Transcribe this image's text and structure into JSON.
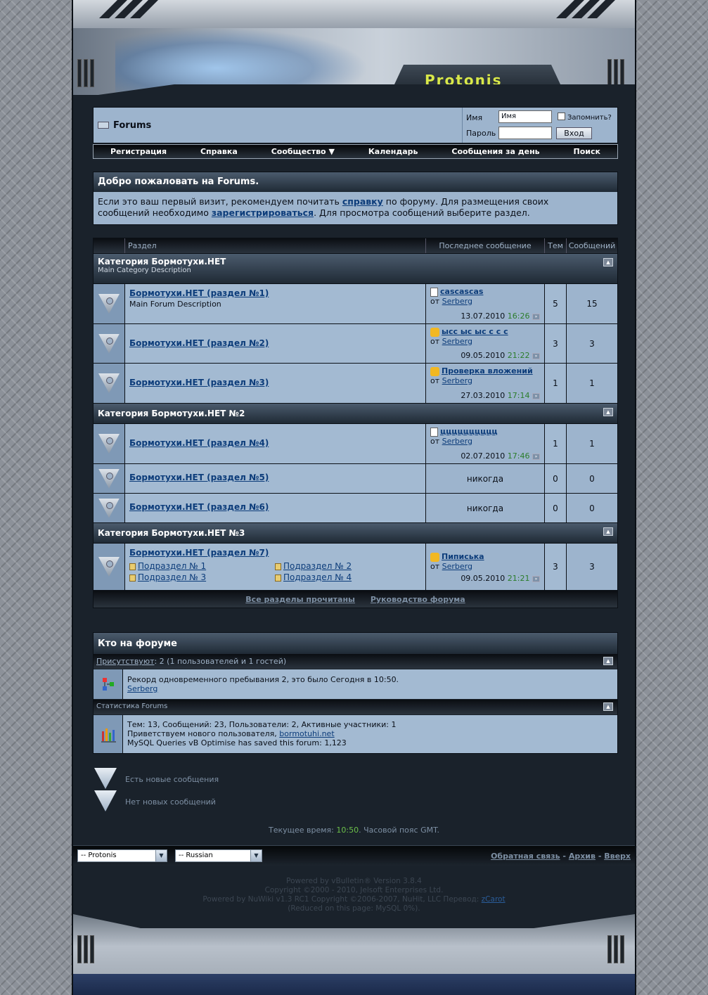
{
  "site": {
    "logo": "Protonis",
    "forum_title": "Forums"
  },
  "login": {
    "user_label": "Имя",
    "user_value": "Имя",
    "remember_label": "Запомнить?",
    "pass_label": "Пароль",
    "login_button": "Вход"
  },
  "nav": [
    "Регистрация",
    "Справка",
    "Сообщество",
    "Календарь",
    "Сообщения за день",
    "Поиск"
  ],
  "welcome": {
    "title": "Добро пожаловать на Forums.",
    "text1": "Если это ваш первый визит, рекомендуем почитать ",
    "link1": "справку",
    "text2": " по форуму. Для размещения своих",
    "text3": "сообщений необходимо ",
    "link2": "зарегистрироваться",
    "text4": ". Для просмотра сообщений выберите раздел."
  },
  "table_headers": {
    "forum": "Раздел",
    "last": "Последнее сообщение",
    "threads": "Тем",
    "posts": "Сообщений"
  },
  "categories": [
    {
      "title": "Категория Бормотухи.НЕТ",
      "desc": "Main Category Description"
    },
    {
      "title": "Категория Бормотухи.НЕТ №2"
    },
    {
      "title": "Категория Бормотухи.НЕТ №3"
    }
  ],
  "forums": [
    {
      "name": "Бормотухи.НЕТ (раздел №1)",
      "desc": "Main Forum Description",
      "last_title": "cascascas",
      "by": "от",
      "user": "Serberg",
      "date": "13.07.2010",
      "time": "16:26",
      "threads": "5",
      "posts": "15"
    },
    {
      "name": "Бормотухи.НЕТ (раздел №2)",
      "last_title": "ысс ыс ыс с с с",
      "by": "от",
      "user": "Serberg",
      "date": "09.05.2010",
      "time": "21:22",
      "threads": "3",
      "posts": "3"
    },
    {
      "name": "Бормотухи.НЕТ (раздел №3)",
      "last_title": "Проверка вложений",
      "by": "от",
      "user": "Serberg",
      "date": "27.03.2010",
      "time": "17:14",
      "threads": "1",
      "posts": "1"
    },
    {
      "name": "Бормотухи.НЕТ (раздел №4)",
      "last_title": "цццццццццц",
      "by": "от",
      "user": "Serberg",
      "date": "02.07.2010",
      "time": "17:46",
      "threads": "1",
      "posts": "1"
    },
    {
      "name": "Бормотухи.НЕТ (раздел №5)",
      "never": "никогда",
      "threads": "0",
      "posts": "0"
    },
    {
      "name": "Бормотухи.НЕТ (раздел №6)",
      "never": "никогда",
      "threads": "0",
      "posts": "0"
    },
    {
      "name": "Бормотухи.НЕТ (раздел №7)",
      "subs": [
        "Подраздел № 1",
        "Подраздел № 2",
        "Подраздел № 3",
        "Подраздел № 4"
      ],
      "last_title": "Пиписька",
      "by": "от",
      "user": "Serberg",
      "date": "09.05.2010",
      "time": "21:21",
      "threads": "3",
      "posts": "3"
    }
  ],
  "footer_links": {
    "mark_read": "Все разделы прочитаны",
    "leaders": "Руководство форума"
  },
  "who": {
    "title": "Кто на форуме",
    "present_link": "Присутствуют",
    "present_text": ": 2 (1 пользователей и 1 гостей)",
    "record": "Рекорд одновременного пребывания 2, это было Сегодня в 10:50.",
    "user": "Serberg"
  },
  "stats": {
    "title": "Статистика Forums",
    "line1": "Тем: 13, Сообщений: 23, Пользователи: 2, Активные участники: 1",
    "line2": "Приветствуем нового пользователя, ",
    "new_user": "bormotuhi.net",
    "line3": "MySQL Queries vB Optimise has saved this forum: 1,123"
  },
  "legend": {
    "new": "Есть новые сообщения",
    "old": "Нет новых сообщений"
  },
  "time": {
    "prefix": "Текущее время: ",
    "value": "10:50",
    "suffix": ". Часовой пояс GMT."
  },
  "bottom": {
    "style_select": "-- Protonis",
    "lang_select": "-- Russian",
    "contact": "Обратная связь",
    "archive": "Архив",
    "top": "Вверх"
  },
  "copyright": {
    "l1": "Powered by vBulletin® Version 3.8.4",
    "l2": "Copyright ©2000 - 2010, Jelsoft Enterprises Ltd.",
    "l3": "Powered by NuWiki v1.3 RC1 Copyright ©2006-2007, NuHit, LLC Перевод: ",
    "l3link": "zCarot",
    "l4": "(Reduced on this page: MySQL 0%)."
  }
}
